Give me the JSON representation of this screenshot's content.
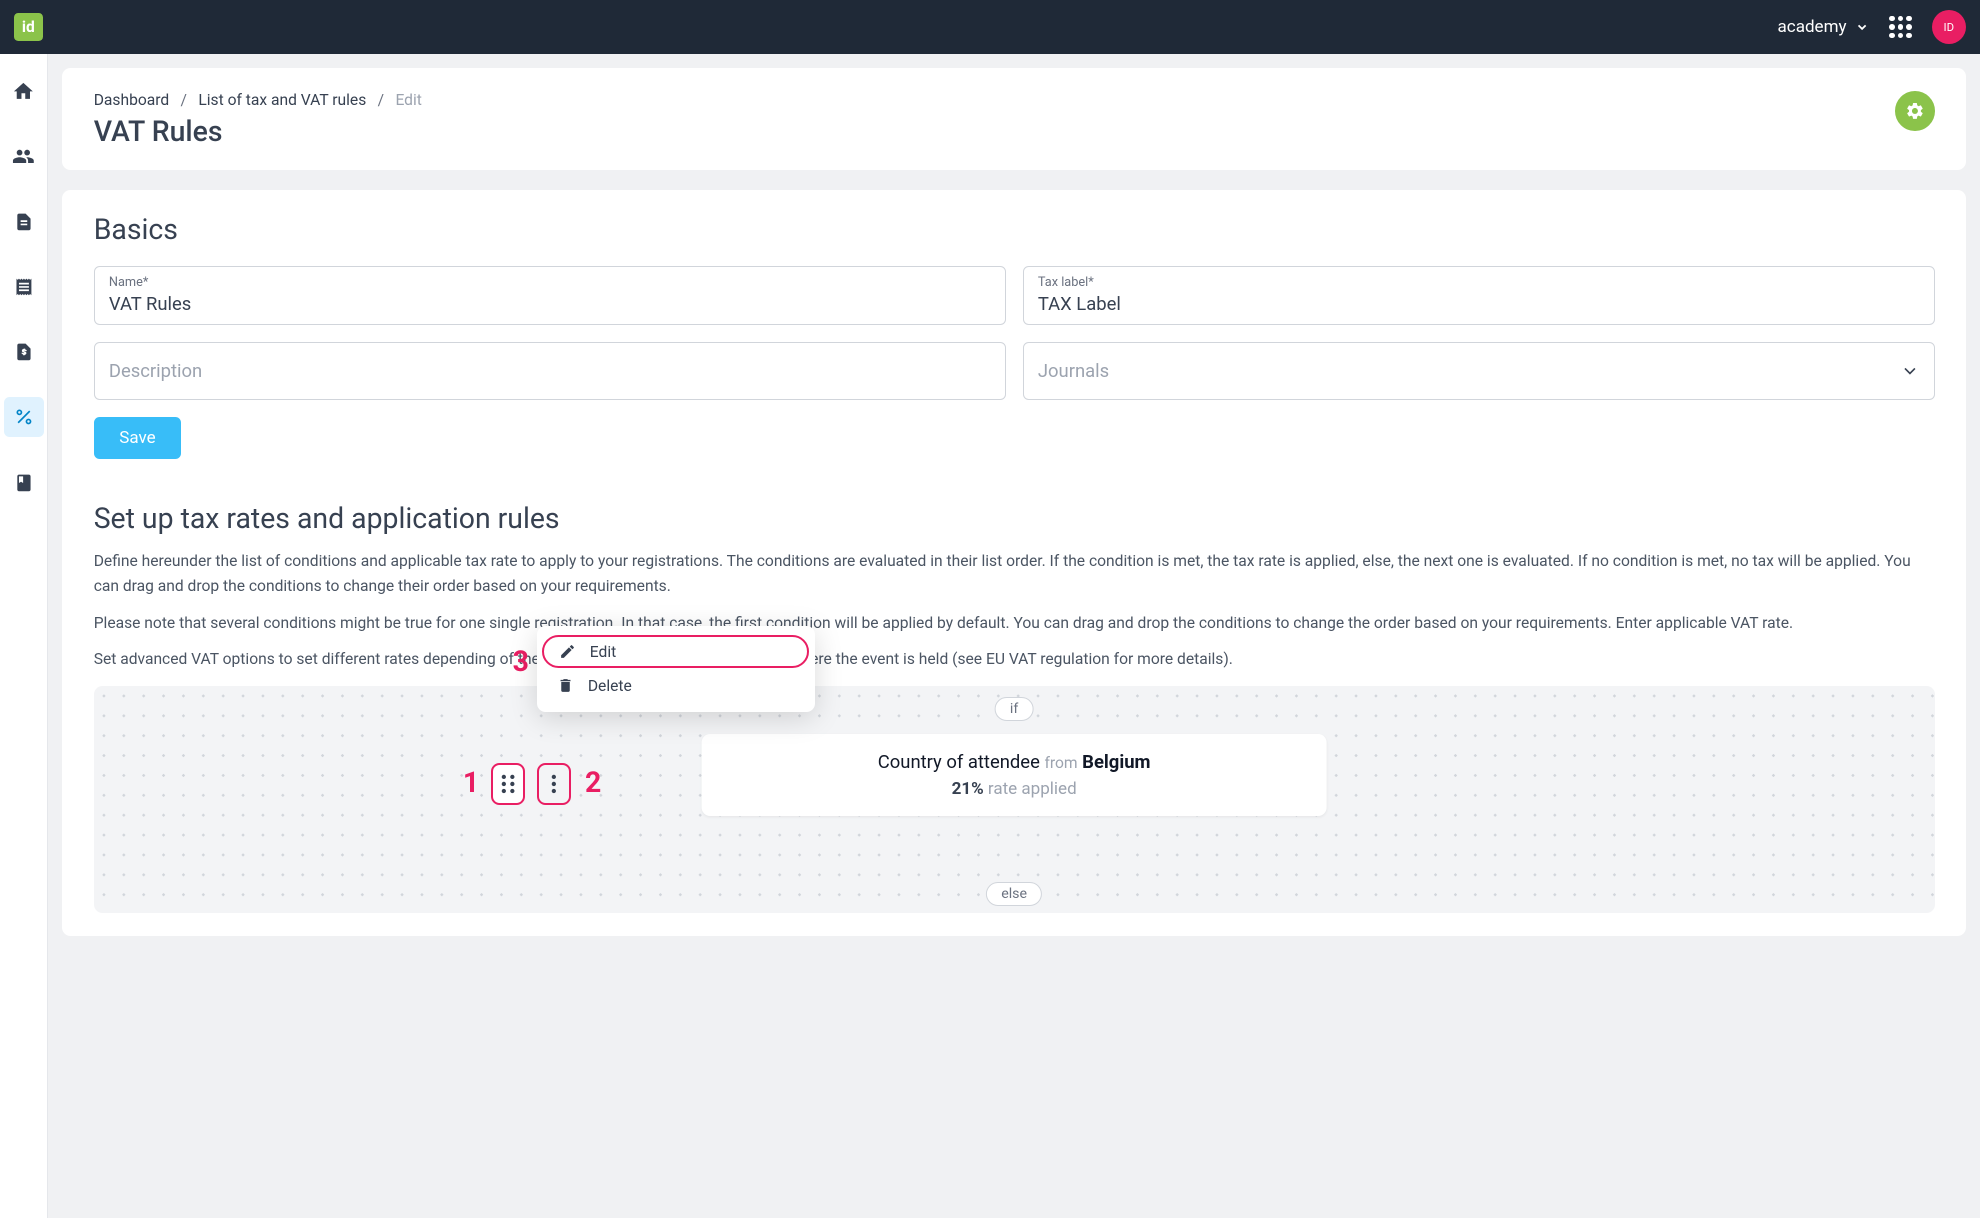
{
  "topbar": {
    "workspace": "academy",
    "avatar": "ID"
  },
  "breadcrumb": {
    "dashboard": "Dashboard",
    "list": "List of tax and VAT rules",
    "current": "Edit"
  },
  "page_title": "VAT Rules",
  "basics": {
    "heading": "Basics",
    "name_label": "Name*",
    "name_value": "VAT Rules",
    "tax_label_label": "Tax label*",
    "tax_label_value": "TAX Label",
    "description_placeholder": "Description",
    "journals_placeholder": "Journals",
    "save": "Save"
  },
  "rules": {
    "heading": "Set up tax rates and application rules",
    "p1": "Define hereunder the list of conditions and applicable tax rate to apply to your registrations. The conditions are evaluated in their list order. If the condition is met, the tax rate is applied, else, the next one is evaluated. If no condition is met, no tax will be applied. You can drag and drop the conditions to change their order based on your requirements.",
    "p2": "Please note that several conditions might be true for one single registration. In that case, the first condition will be applied by default. You can drag and drop the conditions to change the order based on your requirements. Enter applicable VAT rate.",
    "p3": "Set advanced VAT options to set different rates depending of the registrants country and the country where the event is held (see EU VAT regulation for more details).",
    "if": "if",
    "else": "else",
    "condition_label": "Country of attendee",
    "condition_from": "from",
    "condition_country": "Belgium",
    "rate_value": "21%",
    "rate_text": "rate applied"
  },
  "popup": {
    "edit": "Edit",
    "delete": "Delete"
  },
  "annotations": {
    "n1": "1",
    "n2": "2",
    "n3": "3"
  }
}
